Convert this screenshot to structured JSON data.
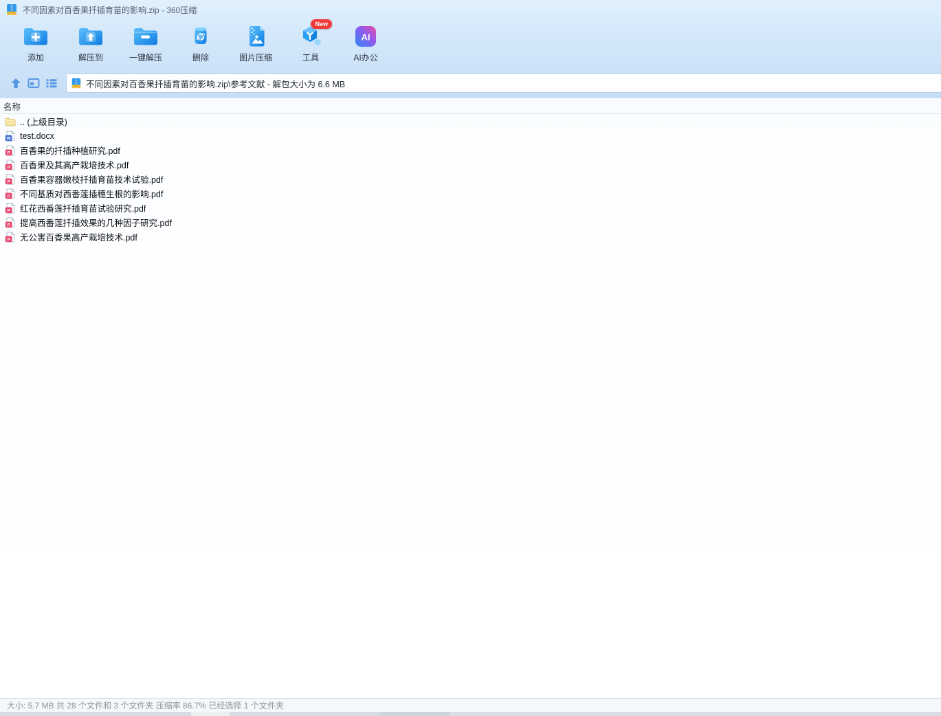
{
  "window": {
    "title": "不同因素对百香果扦插育苗的影响.zip - 360压缩"
  },
  "toolbar": {
    "items": [
      {
        "label": "添加",
        "icon": "add-folder-icon"
      },
      {
        "label": "解压到",
        "icon": "extract-to-icon"
      },
      {
        "label": "一键解压",
        "icon": "one-click-extract-icon"
      },
      {
        "label": "删除",
        "icon": "delete-trash-icon"
      },
      {
        "label": "图片压缩",
        "icon": "image-compress-icon"
      },
      {
        "label": "工具",
        "icon": "tools-cube-icon",
        "badge": "New"
      },
      {
        "label": "AI办公",
        "icon": "ai-office-icon"
      }
    ]
  },
  "address": {
    "path": "不同因素对百香果扦插育苗的影响.zip\\参考文献 - 解包大小为 6.6 MB"
  },
  "list": {
    "header": "名称",
    "files": [
      {
        "name": ".. (上级目录)",
        "icon": "folder"
      },
      {
        "name": "test.docx",
        "icon": "docx"
      },
      {
        "name": "百香果的扦插种植研究.pdf",
        "icon": "pdf"
      },
      {
        "name": "百香果及其高产栽培技术.pdf",
        "icon": "pdf"
      },
      {
        "name": "百香果容器嫩枝扦插育苗技术试验.pdf",
        "icon": "pdf"
      },
      {
        "name": "不同基质对西番莲插穗生根的影响.pdf",
        "icon": "pdf"
      },
      {
        "name": "红花西番莲扦插育苗试验研究.pdf",
        "icon": "pdf"
      },
      {
        "name": "提高西番莲扦插效果的几种因子研究.pdf",
        "icon": "pdf"
      },
      {
        "name": "无公害百香果高产栽培技术.pdf",
        "icon": "pdf"
      }
    ]
  },
  "statusbar": {
    "text": "大小: 5.7 MB 共 28 个文件和 3 个文件夹 压缩率 86.7% 已经选择 1 个文件夹"
  },
  "colors": {
    "accent_blue": "#1e88e5",
    "panel_blue": "#d4e8fa",
    "pdf_pink": "#e8486f",
    "word_blue": "#3f6fd8",
    "folder_yellow": "#f6e7a2",
    "badge_red": "#f03b3b",
    "status_gray": "#8d969e"
  }
}
